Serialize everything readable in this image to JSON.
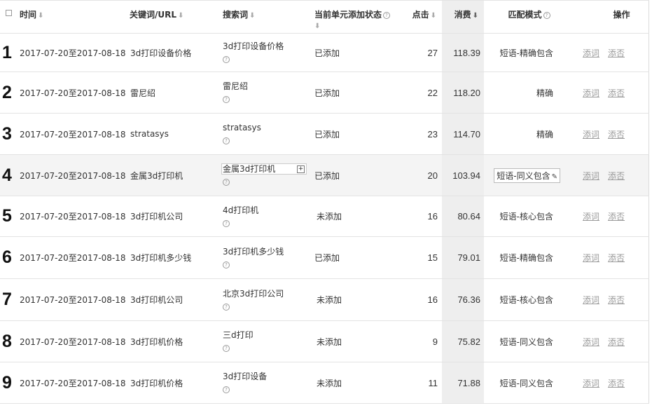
{
  "header": {
    "time": "时间",
    "keyword": "关键词/URL",
    "search_term": "搜索词",
    "add_status": "当前单元添加状态",
    "clicks": "点击",
    "cost": "消费",
    "match": "匹配模式",
    "ops": "操作"
  },
  "icons": {
    "sort": "sort-arrow-icon",
    "help": "question-circle-icon",
    "checkbox": "checkbox-icon",
    "expand": "plus-box-icon",
    "edit": "pencil-edit-icon"
  },
  "rows": [
    {
      "num": "1",
      "date": "2017-07-20至2017-08-18",
      "keyword": "3d打印设备价格",
      "search_term": "3d打印设备价格",
      "status": "已添加",
      "clicks": "27",
      "cost": "118.39",
      "match": "短语-精确包含",
      "add_word": "添词",
      "add_negative": "添否"
    },
    {
      "num": "2",
      "date": "2017-07-20至2017-08-18",
      "keyword": "雷尼绍",
      "search_term": "雷尼绍",
      "status": "已添加",
      "clicks": "22",
      "cost": "118.20",
      "match": "精确",
      "add_word": "添词",
      "add_negative": "添否"
    },
    {
      "num": "3",
      "date": "2017-07-20至2017-08-18",
      "keyword": "stratasys",
      "search_term": "stratasys",
      "status": "已添加",
      "clicks": "23",
      "cost": "114.70",
      "match": "精确",
      "add_word": "添词",
      "add_negative": "添否"
    },
    {
      "num": "4",
      "date": "2017-07-20至2017-08-18",
      "keyword": "金属3d打印机",
      "search_term": "金属3d打印机",
      "status": "已添加",
      "clicks": "20",
      "cost": "103.94",
      "match": "短语-同义包含",
      "add_word": "添词",
      "add_negative": "添否"
    },
    {
      "num": "5",
      "date": "2017-07-20至2017-08-18",
      "keyword": "3d打印机公司",
      "search_term": "4d打印机",
      "status": "未添加",
      "clicks": "16",
      "cost": "80.64",
      "match": "短语-核心包含",
      "add_word": "添词",
      "add_negative": "添否"
    },
    {
      "num": "6",
      "date": "2017-07-20至2017-08-18",
      "keyword": "3d打印机多少钱",
      "search_term": "3d打印机多少钱",
      "status": "已添加",
      "clicks": "15",
      "cost": "79.01",
      "match": "短语-精确包含",
      "add_word": "添词",
      "add_negative": "添否"
    },
    {
      "num": "7",
      "date": "2017-07-20至2017-08-18",
      "keyword": "3d打印机公司",
      "search_term": "北京3d打印公司",
      "status": "未添加",
      "clicks": "16",
      "cost": "76.36",
      "match": "短语-核心包含",
      "add_word": "添词",
      "add_negative": "添否"
    },
    {
      "num": "8",
      "date": "2017-07-20至2017-08-18",
      "keyword": "3d打印机价格",
      "search_term": "三d打印",
      "status": "未添加",
      "clicks": "9",
      "cost": "75.82",
      "match": "短语-同义包含",
      "add_word": "添词",
      "add_negative": "添否"
    },
    {
      "num": "9",
      "date": "2017-07-20至2017-08-18",
      "keyword": "3d打印机价格",
      "search_term": "3d打印设备",
      "status": "未添加",
      "clicks": "11",
      "cost": "71.88",
      "match": "短语-同义包含",
      "add_word": "添词",
      "add_negative": "添否"
    }
  ]
}
